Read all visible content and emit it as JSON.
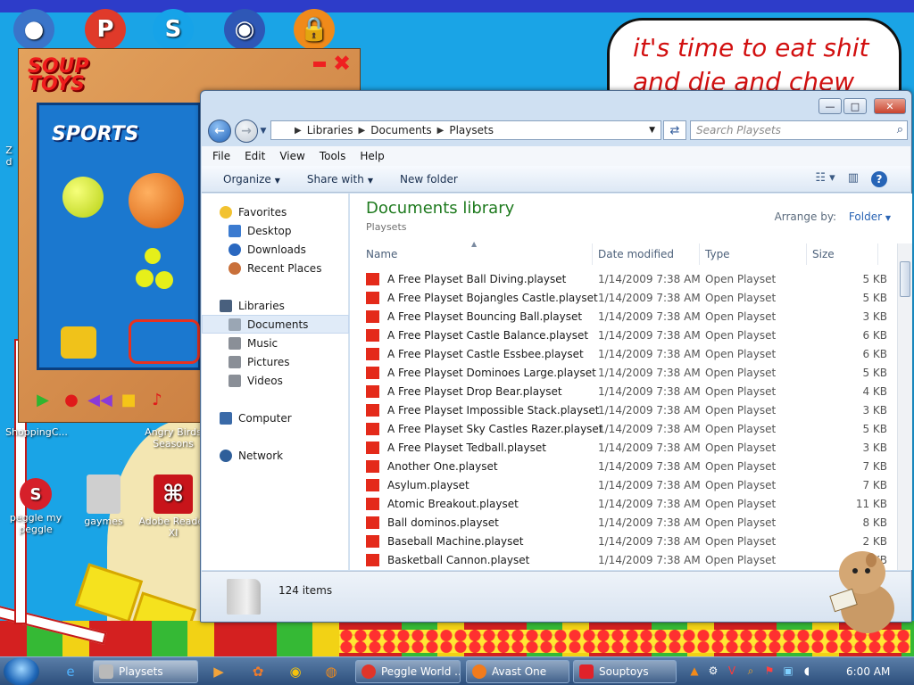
{
  "desktop": {
    "bubble_text": "it's time to eat shit and die and chew",
    "icons": [
      {
        "name": "W",
        "color": "#3a74c9"
      },
      {
        "name": "",
        "color": "#e03a2a"
      },
      {
        "name": "",
        "color": "#16a3e8"
      },
      {
        "name": "",
        "color": "#2e57b6"
      },
      {
        "name": "",
        "color": "#f08a1a"
      }
    ],
    "left_labels": {
      "z": "Z",
      "d": "d"
    },
    "shopping_label": "ShoppingC...",
    "angry_birds_label": "Angry Birds Seasons",
    "peggle_label": "peggle my peggle",
    "gaymes_label": "gaymes",
    "adobe_label": "Adobe Reader XI"
  },
  "souptoys": {
    "logo_line1": "SOUP",
    "logo_line2": "TOYS",
    "panel_title": "SPORTS"
  },
  "explorer": {
    "breadcrumb": [
      "Libraries",
      "Documents",
      "Playsets"
    ],
    "search_placeholder": "Search Playsets",
    "menu": [
      "File",
      "Edit",
      "View",
      "Tools",
      "Help"
    ],
    "commands": {
      "organize": "Organize",
      "share": "Share with",
      "new_folder": "New folder"
    },
    "nav": {
      "favorites": "Favorites",
      "desktop": "Desktop",
      "downloads": "Downloads",
      "recent": "Recent Places",
      "libraries": "Libraries",
      "documents": "Documents",
      "music": "Music",
      "pictures": "Pictures",
      "videos": "Videos",
      "computer": "Computer",
      "network": "Network"
    },
    "library_title": "Documents library",
    "library_sub": "Playsets",
    "arrange_label": "Arrange by:",
    "arrange_value": "Folder",
    "columns": {
      "name": "Name",
      "date": "Date modified",
      "type": "Type",
      "size": "Size"
    },
    "files": [
      {
        "name": "A Free Playset Ball Diving.playset",
        "date": "1/14/2009 7:38 AM",
        "type": "Open Playset",
        "size": "5 KB"
      },
      {
        "name": "A Free Playset Bojangles Castle.playset",
        "date": "1/14/2009 7:38 AM",
        "type": "Open Playset",
        "size": "5 KB"
      },
      {
        "name": "A Free Playset Bouncing Ball.playset",
        "date": "1/14/2009 7:38 AM",
        "type": "Open Playset",
        "size": "3 KB"
      },
      {
        "name": "A Free Playset Castle Balance.playset",
        "date": "1/14/2009 7:38 AM",
        "type": "Open Playset",
        "size": "6 KB"
      },
      {
        "name": "A Free Playset Castle Essbee.playset",
        "date": "1/14/2009 7:38 AM",
        "type": "Open Playset",
        "size": "6 KB"
      },
      {
        "name": "A Free Playset Dominoes Large.playset",
        "date": "1/14/2009 7:38 AM",
        "type": "Open Playset",
        "size": "5 KB"
      },
      {
        "name": "A Free Playset Drop Bear.playset",
        "date": "1/14/2009 7:38 AM",
        "type": "Open Playset",
        "size": "4 KB"
      },
      {
        "name": "A Free Playset Impossible Stack.playset",
        "date": "1/14/2009 7:38 AM",
        "type": "Open Playset",
        "size": "3 KB"
      },
      {
        "name": "A Free Playset Sky Castles Razer.playset",
        "date": "1/14/2009 7:38 AM",
        "type": "Open Playset",
        "size": "5 KB"
      },
      {
        "name": "A Free Playset Tedball.playset",
        "date": "1/14/2009 7:38 AM",
        "type": "Open Playset",
        "size": "3 KB"
      },
      {
        "name": "Another One.playset",
        "date": "1/14/2009 7:38 AM",
        "type": "Open Playset",
        "size": "7 KB"
      },
      {
        "name": "Asylum.playset",
        "date": "1/14/2009 7:38 AM",
        "type": "Open Playset",
        "size": "7 KB"
      },
      {
        "name": "Atomic Breakout.playset",
        "date": "1/14/2009 7:38 AM",
        "type": "Open Playset",
        "size": "11 KB"
      },
      {
        "name": "Ball dominos.playset",
        "date": "1/14/2009 7:38 AM",
        "type": "Open Playset",
        "size": "8 KB"
      },
      {
        "name": "Baseball Machine.playset",
        "date": "1/14/2009 7:38 AM",
        "type": "Open Playset",
        "size": "2 KB"
      },
      {
        "name": "Basketball Cannon.playset",
        "date": "1/14/2009 7:38 AM",
        "type": "Open Playset",
        "size": "5 KB"
      }
    ],
    "item_count": "124 items"
  },
  "taskbar": {
    "tasks": [
      {
        "label": "Playsets",
        "icon_color": "#b9b9b9",
        "active": true
      },
      {
        "label": "Peggle World ...",
        "icon_color": "#e0352a",
        "active": false
      },
      {
        "label": "Avast One",
        "icon_color": "#f27b1c",
        "active": false
      },
      {
        "label": "Souptoys",
        "icon_color": "#e0222a",
        "active": false
      }
    ],
    "clock": "6:00 AM"
  }
}
